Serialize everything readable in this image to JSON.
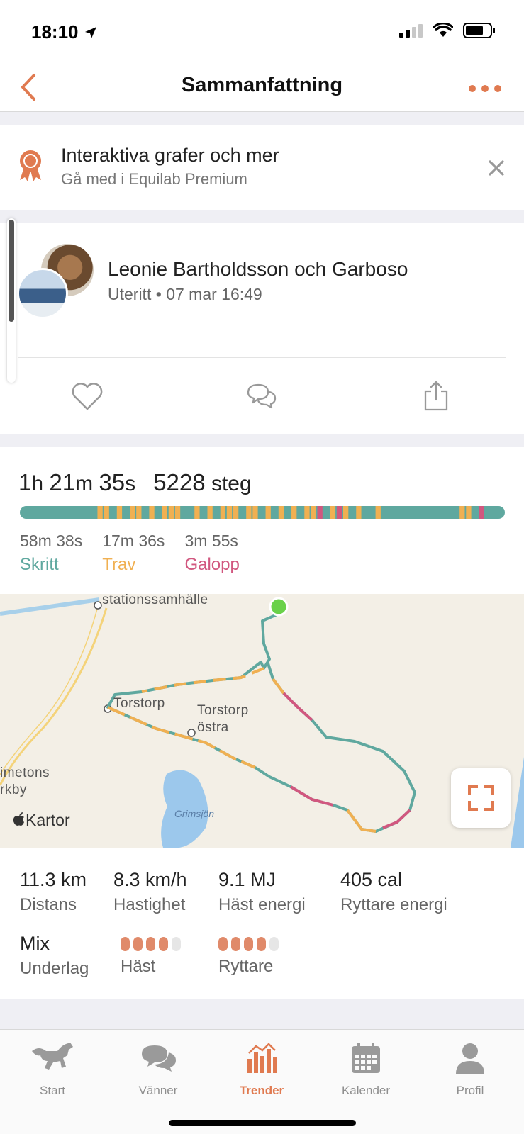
{
  "colors": {
    "accent": "#e07a50",
    "walk": "#5fa89f",
    "trot": "#f0b052",
    "canter": "#d1577f",
    "inactive": "#8e8e8e"
  },
  "status_bar": {
    "time": "18:10"
  },
  "nav": {
    "title": "Sammanfattning"
  },
  "promo": {
    "title": "Interaktiva grafer och mer",
    "subtitle": "Gå med i Equilab Premium"
  },
  "ride_header": {
    "names": "Leonie Bartholdsson och Garboso",
    "type": "Uteritt",
    "separator": "•",
    "datetime": "07 mar 16:49"
  },
  "ride": {
    "h": "1",
    "h_unit": "h",
    "m": "21",
    "m_unit": "m",
    "s": "35",
    "s_unit": "s",
    "steps": "5228",
    "steps_unit": "steg",
    "gaits": [
      {
        "time": "58m 38s",
        "label": "Skritt"
      },
      {
        "time": "17m 36s",
        "label": "Trav"
      },
      {
        "time": "3m 55s",
        "label": "Galopp"
      }
    ]
  },
  "map": {
    "labels": {
      "station": "stationssamhälle",
      "torstorp": "Torstorp",
      "torstorp_ostra_1": "Torstorp",
      "torstorp_ostra_2": "östra",
      "imetons_1": "imetons",
      "imetons_2": "rkby",
      "lake": "Grimsjön"
    },
    "credit": "Kartor"
  },
  "stats": [
    {
      "value": "11.3 km",
      "label": "Distans"
    },
    {
      "value": "8.3 km/h",
      "label": "Hastighet"
    },
    {
      "value": "9.1 MJ",
      "label": "Häst energi"
    },
    {
      "value": "405 cal",
      "label": "Ryttare energi"
    }
  ],
  "surface": {
    "value": "Mix",
    "label": "Underlag",
    "horse_label": "Häst",
    "horse_rating": 4,
    "rider_label": "Ryttare",
    "rider_rating": 4,
    "rating_max": 5
  },
  "tabs": [
    {
      "label": "Start",
      "icon": "horse-icon",
      "active": false
    },
    {
      "label": "Vänner",
      "icon": "chat-icon",
      "active": false
    },
    {
      "label": "Trender",
      "icon": "bar-chart-icon",
      "active": true
    },
    {
      "label": "Kalender",
      "icon": "calendar-icon",
      "active": false
    },
    {
      "label": "Profil",
      "icon": "profile-icon",
      "active": false
    }
  ]
}
